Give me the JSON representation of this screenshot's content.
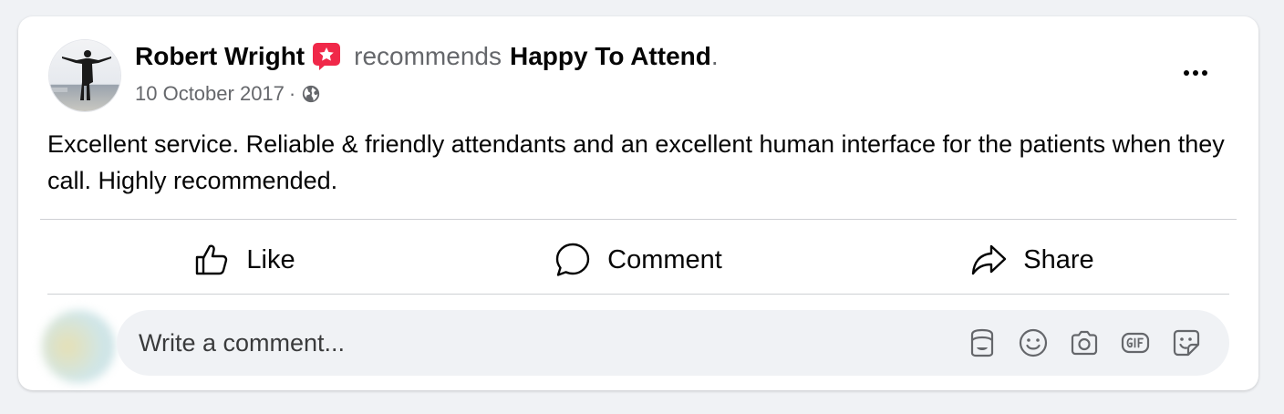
{
  "post": {
    "author": "Robert Wright",
    "verb": "recommends",
    "page_name": "Happy To Attend",
    "page_suffix": ".",
    "date": "10 October 2017",
    "separator": "·",
    "audience_icon": "globe-icon",
    "text": "Excellent service. Reliable & friendly attendants and an excellent human interface for the patients when they call. Highly recommended."
  },
  "actions": {
    "like_label": "Like",
    "comment_label": "Comment",
    "share_label": "Share"
  },
  "comment_box": {
    "placeholder": "Write a comment...",
    "tools": [
      "avatar-sticker-icon",
      "emoji-icon",
      "camera-icon",
      "gif-icon",
      "sticker-icon"
    ]
  },
  "colors": {
    "recommend_badge": "#f02849",
    "secondary_text": "#65676b",
    "comment_bg": "#f0f2f5",
    "card_bg": "#ffffff",
    "page_bg": "#f0f2f5"
  }
}
